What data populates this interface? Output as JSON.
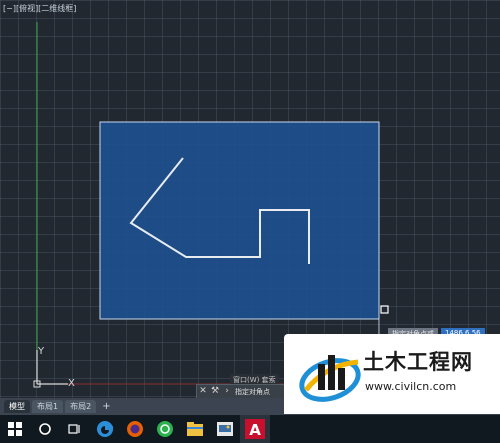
{
  "viewport": {
    "label": "[−][俯视][二维线框]",
    "axis_x": "X",
    "axis_y": "Y"
  },
  "command": {
    "history": "窗口(W) 套索",
    "prompt": "指定对角点"
  },
  "coord_tooltip": {
    "label": "指定对角点或",
    "value": "1486.6.56"
  },
  "layout_tabs": [
    "模型",
    "布局1",
    "布局2"
  ],
  "taskbar_icons": [
    "windows-start",
    "search",
    "task-view",
    "edge",
    "firefox",
    "wechat",
    "file-explorer",
    "photos",
    "autocad"
  ],
  "watermark": {
    "title": "土木工程网",
    "url": "www.civilcn.com"
  },
  "colors": {
    "selection_fill": "#1d4f8f",
    "drawing_line": "#e8ecf0",
    "background": "#212830"
  }
}
